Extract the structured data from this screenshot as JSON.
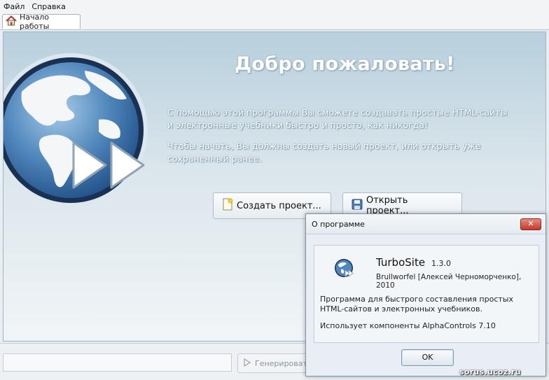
{
  "menu": {
    "items": [
      "Файл",
      "Справка"
    ]
  },
  "tab": {
    "label": "Начало работы",
    "icon": "home-icon"
  },
  "welcome": {
    "title": "Добро пожаловать!",
    "paragraph1_line1": "С помощью этой программы Вы сможете создавать простые HTML-сайты",
    "paragraph1_line2": "и электронные учебники быстро и просто, как никогда!",
    "paragraph2_line1": "Чтобы начать, Вы должны создать новый проект, или открыть уже",
    "paragraph2_line2": "сохраненный ранее."
  },
  "buttons": {
    "create": "Создать проект...",
    "open": "Открыть проект..."
  },
  "bottom": {
    "generate_label": "Генерировать"
  },
  "about_dialog": {
    "title": "О программе",
    "close_label": "✕",
    "app_name": "TurboSite",
    "version": "1.3.0",
    "author": "Brullworfel [Алексей Черноморченко], 2010",
    "description_line1": "Программа для быстрого составления простых",
    "description_line2": "HTML-сайтов и электронных учебников.",
    "components": "Использует компоненты AlphaControls 7.10",
    "ok_label": "OK"
  },
  "watermark": "sorus.ucoz.ru",
  "colors": {
    "accent": "#2f5f8e",
    "close_button": "#c3392a"
  }
}
